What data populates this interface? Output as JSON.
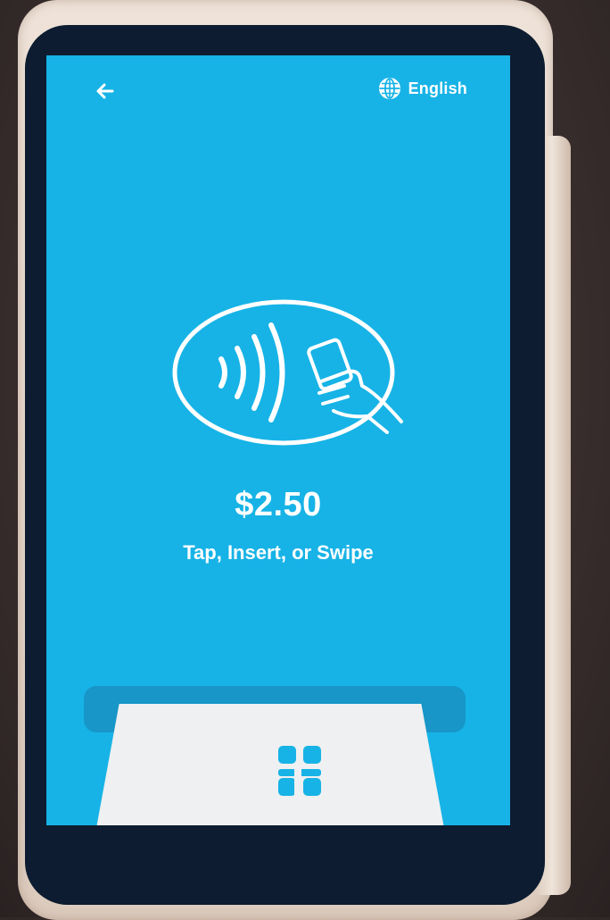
{
  "header": {
    "back_icon": "arrow-left-icon",
    "language_icon": "globe-icon",
    "language_label": "English"
  },
  "payment": {
    "amount": "$2.50",
    "instruction": "Tap, Insert, or Swipe",
    "illustration_icon": "contactless-tap-icon",
    "chip_icon": "card-chip-icon"
  },
  "colors": {
    "screen_background": "#17b3e6",
    "text": "#ffffff",
    "card": "#eef0f1",
    "slot": "#1796c7",
    "chip": "#17b3e6"
  }
}
